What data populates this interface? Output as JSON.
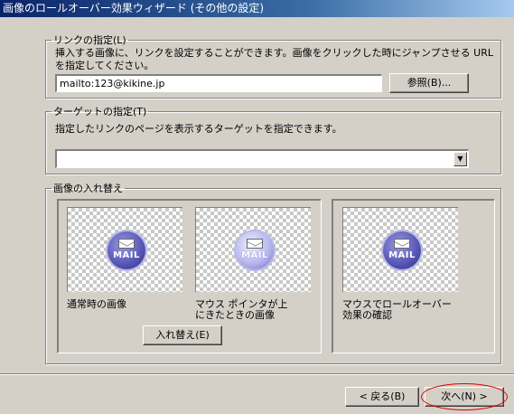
{
  "window": {
    "title": "画像のロールオーバー効果ウィザード (その他の設定)"
  },
  "link_group": {
    "legend": "リンクの指定(L)",
    "description": "挿入する画像に、リンクを設定することができます。画像をクリックした時にジャンプさせる URL を指定してください。",
    "url_value": "mailto:123@kikine.jp",
    "browse_label": "参照(B)..."
  },
  "target_group": {
    "legend": "ターゲットの指定(T)",
    "description": "指定したリンクのページを表示するターゲットを指定できます。",
    "selected_value": ""
  },
  "swap_group": {
    "legend": "画像の入れ替え",
    "normal_caption": "通常時の画像",
    "hover_caption": "マウス ポインタが上にきたときの画像",
    "swap_label": "入れ替え(E)",
    "preview_caption": "マウスでロールオーバー効果の確認",
    "icon_text": "MAIL"
  },
  "footer": {
    "back_label": "< 戻る(B)",
    "next_label": "次へ(N) >"
  },
  "colors": {
    "annotation_ellipse": "#e00000",
    "titlebar": "#0a246a"
  },
  "icons": [
    "mail-icon",
    "combo-arrow-icon"
  ]
}
